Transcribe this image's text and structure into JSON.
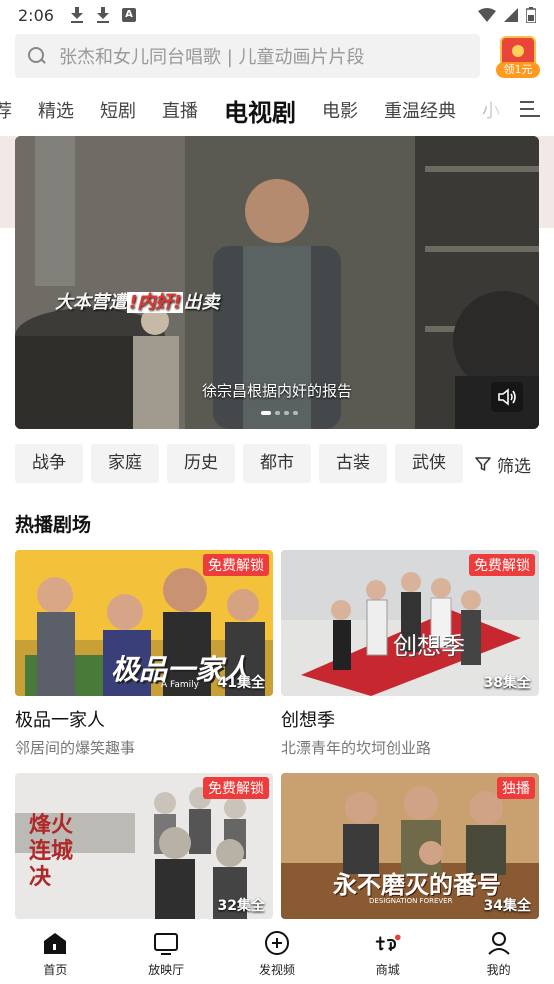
{
  "status_bar": {
    "time": "2:06",
    "left_icons": [
      "download-icon",
      "download-icon",
      "a-badge-icon"
    ],
    "right_icons": [
      "wifi-icon",
      "signal-icon",
      "battery-icon"
    ]
  },
  "search": {
    "placeholder": "张杰和女儿同台唱歌 | 儿童动画片片段"
  },
  "reward": {
    "label": "领1元",
    "icon": "red-envelope-icon"
  },
  "tabs": [
    {
      "label": "荐",
      "active": false
    },
    {
      "label": "精选",
      "active": false
    },
    {
      "label": "短剧",
      "active": false
    },
    {
      "label": "直播",
      "active": false
    },
    {
      "label": "电视剧",
      "active": true
    },
    {
      "label": "电影",
      "active": false
    },
    {
      "label": "重温经典",
      "active": false
    },
    {
      "label": "小",
      "active": false
    }
  ],
  "hero": {
    "overlay_pre": "大本营遭",
    "overlay_highlight": "!内奸!",
    "overlay_post": "出卖",
    "caption": "徐宗昌根据内奸的报告",
    "slide_count": 4,
    "active_slide": 1
  },
  "genres": [
    "战争",
    "家庭",
    "历史",
    "都市",
    "古装",
    "武侠"
  ],
  "filter_label": "筛选",
  "section": {
    "title": "热播剧场"
  },
  "cards": [
    {
      "title": "极品一家人",
      "subtitle": "邻居间的爆笑趣事",
      "badge": "免费解锁",
      "episodes": "41集全",
      "poster_text": "极品一家人",
      "poster_sub": "A Family"
    },
    {
      "title": "创想季",
      "subtitle": "北漂青年的坎坷创业路",
      "badge": "免费解锁",
      "episodes": "38集全",
      "poster_text": "创想季",
      "poster_sub": ""
    },
    {
      "title": "",
      "subtitle": "",
      "badge": "免费解锁",
      "episodes": "32集全",
      "poster_text": "烽火连城决",
      "poster_sub": ""
    },
    {
      "title": "",
      "subtitle": "",
      "badge": "独播",
      "episodes": "34集全",
      "poster_text": "永不磨灭的番号",
      "poster_sub": "DESIGNATION FOREVER"
    }
  ],
  "bottom_nav": [
    {
      "label": "首页",
      "icon": "home-icon",
      "active": true
    },
    {
      "label": "放映厅",
      "icon": "tv-icon",
      "active": false
    },
    {
      "label": "发视频",
      "icon": "add-circle-icon",
      "active": false
    },
    {
      "label": "商城",
      "icon": "mall-logo-icon",
      "active": false
    },
    {
      "label": "我的",
      "icon": "profile-icon",
      "active": false
    }
  ],
  "colors": {
    "accent_red": "#ee3b3b",
    "reward_orange": "#ff9a1f",
    "chip_bg": "#f3f3f3"
  }
}
